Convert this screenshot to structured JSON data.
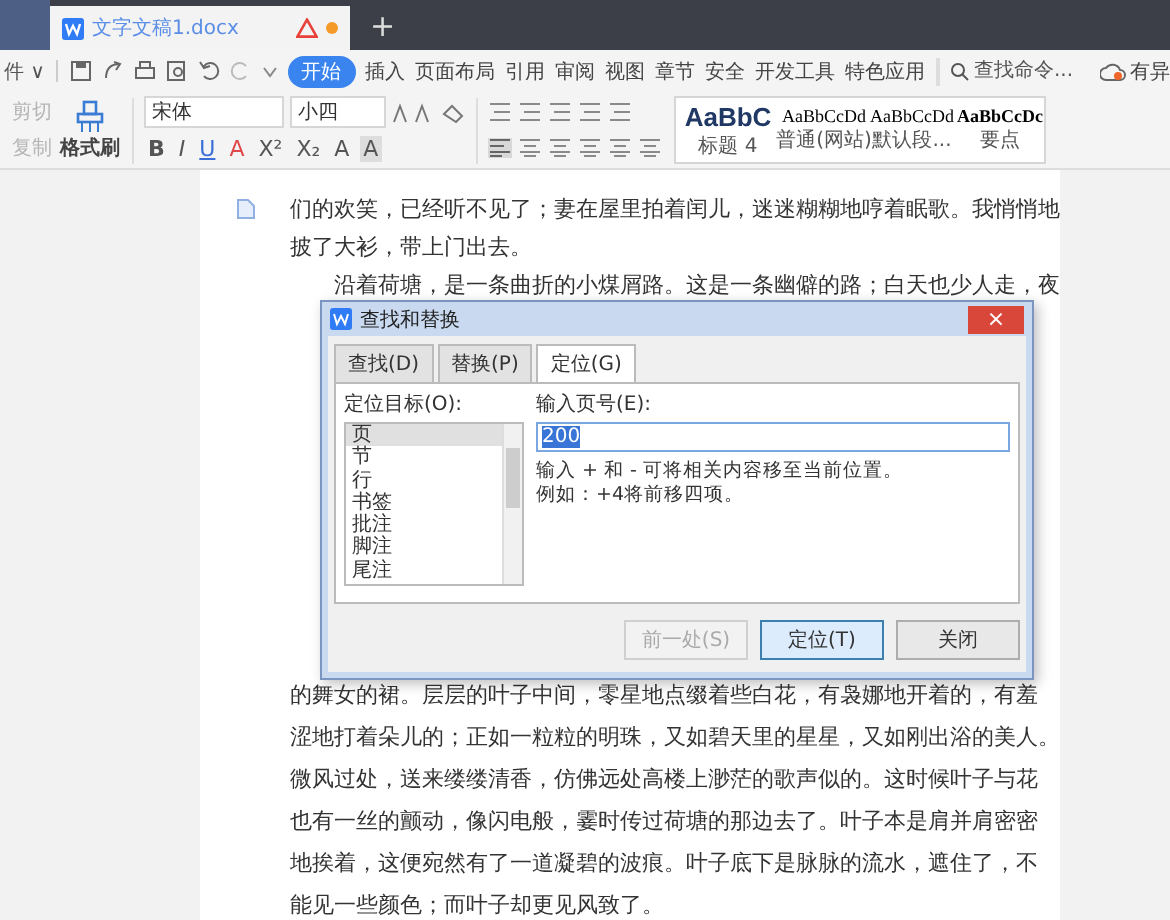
{
  "tab_bar": {
    "document_title": "文字文稿1.docx",
    "new_tab": "+"
  },
  "menu": {
    "file_menu": "件 ∨",
    "tabs": [
      {
        "label": "开始",
        "selected": true
      },
      {
        "label": "插入",
        "selected": false
      },
      {
        "label": "页面布局",
        "selected": false
      },
      {
        "label": "引用",
        "selected": false
      },
      {
        "label": "审阅",
        "selected": false
      },
      {
        "label": "视图",
        "selected": false
      },
      {
        "label": "章节",
        "selected": false
      },
      {
        "label": "安全",
        "selected": false
      },
      {
        "label": "开发工具",
        "selected": false
      },
      {
        "label": "特色应用",
        "selected": false
      }
    ],
    "search": {
      "placeholder": "查找命令..."
    },
    "cloud_label": "有异"
  },
  "ribbon": {
    "cut": {
      "label": "剪切",
      "disabled": true
    },
    "copy": {
      "label": "复制",
      "disabled": true
    },
    "format_painter": "格式刷",
    "font_name": "宋体",
    "font_size": "小四",
    "font_buttons": [
      {
        "label": "B",
        "kind": "bold"
      },
      {
        "label": "I",
        "kind": "italic"
      },
      {
        "label": "U",
        "kind": "underline"
      },
      {
        "label": "A",
        "kind": "color"
      },
      {
        "label": "X²",
        "kind": "plain"
      },
      {
        "label": "X₂",
        "kind": "plain"
      },
      {
        "label": "A",
        "kind": "plain"
      },
      {
        "label": "A",
        "kind": "shade"
      }
    ],
    "styles": [
      {
        "preview": "AaBbC",
        "name": "标题 4",
        "kind": "heading"
      },
      {
        "preview": "AaBbCcDd",
        "name": "普通(网站)",
        "kind": "normal"
      },
      {
        "preview": "AaBbCcDd",
        "name": "默认段...",
        "kind": "normal"
      },
      {
        "preview": "AaBbCcDc",
        "name": "要点",
        "kind": "strong"
      }
    ]
  },
  "document": {
    "lines_above": [
      {
        "text": "们的欢笑，已经听不见了；妻在屋里拍着闰儿，迷迷糊糊地哼着眠歌。我悄悄地",
        "indent": false
      },
      {
        "text": "披了大衫，带上门出去。",
        "indent": false
      },
      {
        "text": "沿着荷塘，是一条曲折的小煤屑路。这是一条幽僻的路；白天也少人走，夜",
        "indent": true
      }
    ],
    "lines_below": [
      {
        "text": "的舞女的裙。层层的叶子中间，零星地点缀着些白花，有袅娜地开着的，有羞",
        "indent": false
      },
      {
        "text": "涩地打着朵儿的；正如一粒粒的明珠，又如碧天里的星星，又如刚出浴的美人。",
        "indent": false
      },
      {
        "text": "微风过处，送来缕缕清香，仿佛远处高楼上渺茫的歌声似的。这时候叶子与花",
        "indent": false
      },
      {
        "text": "也有一丝的颤动，像闪电般，霎时传过荷塘的那边去了。叶子本是肩并肩密密",
        "indent": false
      },
      {
        "text": "地挨着，这便宛然有了一道凝碧的波痕。叶子底下是脉脉的流水，遮住了，不",
        "indent": false
      },
      {
        "text": "能见一些颜色；而叶子却更见风致了。",
        "indent": false
      }
    ]
  },
  "dialog": {
    "title": "查找和替换",
    "close": "×",
    "tabs": [
      {
        "label": "查找(D)",
        "selected": false
      },
      {
        "label": "替换(P)",
        "selected": false
      },
      {
        "label": "定位(G)",
        "selected": true
      }
    ],
    "target_label": "定位目标(O):",
    "targets": [
      {
        "label": "页",
        "selected": true
      },
      {
        "label": "节",
        "selected": false
      },
      {
        "label": "行",
        "selected": false
      },
      {
        "label": "书签",
        "selected": false
      },
      {
        "label": "批注",
        "selected": false
      },
      {
        "label": "脚注",
        "selected": false
      },
      {
        "label": "尾注",
        "selected": false
      }
    ],
    "page_label": "输入页号(E):",
    "page_value": "200",
    "page_value_selected": true,
    "hints": [
      "输入 + 和 - 可将相关内容移至当前位置。",
      "例如：+4将前移四项。"
    ],
    "buttons": [
      {
        "label": "前一处(S)",
        "disabled": true,
        "default": false
      },
      {
        "label": "定位(T)",
        "disabled": false,
        "default": true
      },
      {
        "label": "关闭",
        "disabled": false,
        "default": false
      }
    ]
  }
}
